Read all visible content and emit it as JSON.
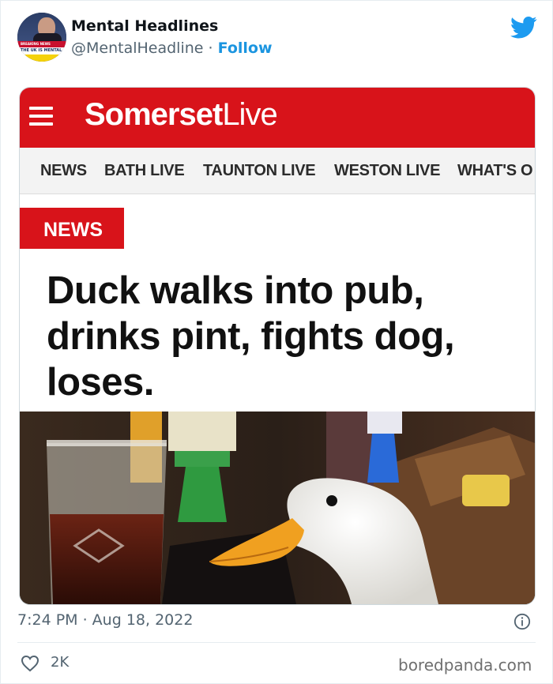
{
  "tweet": {
    "author_name": "Mental Headlines",
    "handle": "@MentalHeadline",
    "separator": "·",
    "follow_label": "Follow",
    "avatar_text_1": "BREAKING NEWS",
    "avatar_text_2": "THE UK IS MENTAL",
    "timestamp": "7:24 PM · Aug 18, 2022",
    "likes": "2K"
  },
  "article": {
    "brand_bold": "Somerset",
    "brand_light": "Live",
    "nav_items": [
      "NEWS",
      "BATH LIVE",
      "TAUNTON LIVE",
      "WESTON LIVE",
      "WHAT'S O"
    ],
    "section_tag": "NEWS",
    "headline": "Duck walks into pub, drinks pint, fights dog, loses."
  },
  "footer": {
    "watermark": "boredpanda.com"
  },
  "colors": {
    "brand_red": "#d8131a",
    "twitter_blue": "#1d9bf0",
    "follow_blue": "#1b95e0",
    "muted_text": "#536471"
  },
  "icons": [
    "twitter-bird-icon",
    "hamburger-menu-icon",
    "info-icon",
    "heart-icon"
  ]
}
